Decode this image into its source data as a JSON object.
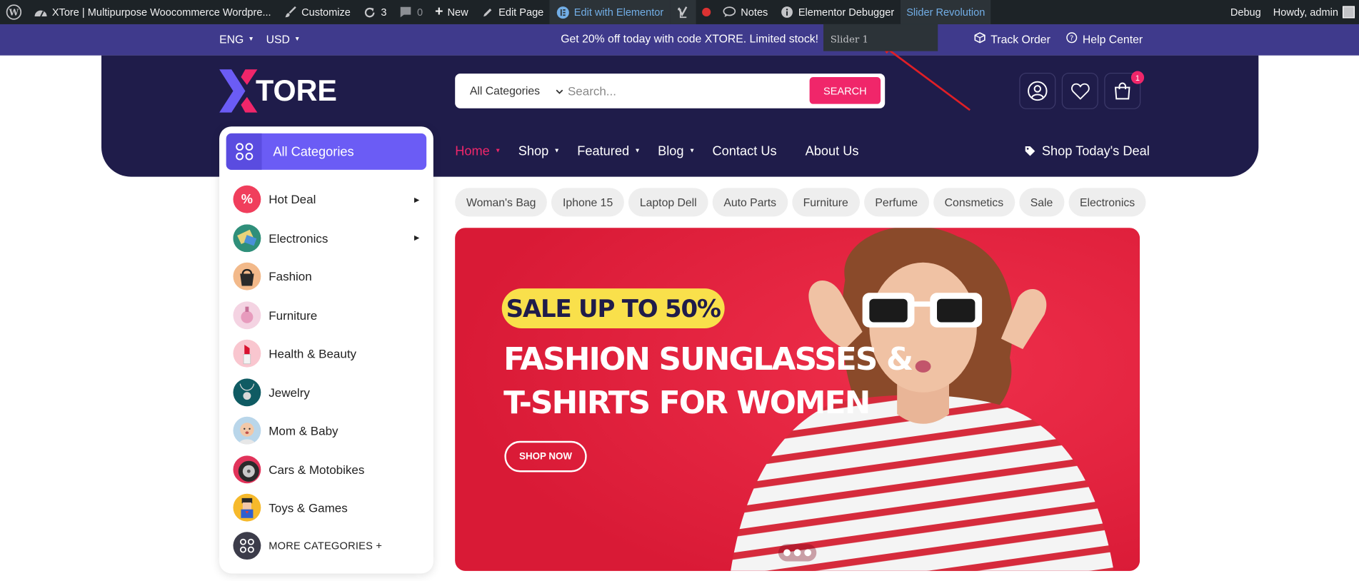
{
  "admin_bar": {
    "site_name": "XTore | Multipurpose Woocommerce Wordpre...",
    "customize": "Customize",
    "updates": "3",
    "comments": "0",
    "new": "New",
    "edit_page": "Edit Page",
    "edit_elementor": "Edit with Elementor",
    "notes": "Notes",
    "debugger": "Elementor Debugger",
    "slider_revolution": "Slider Revolution",
    "debug": "Debug",
    "howdy": "Howdy, admin",
    "dropdown_item": "Slider 1"
  },
  "topbar": {
    "language": "ENG",
    "currency": "USD",
    "promo": "Get 20% off today with code XTORE. Limited stock!",
    "track_order": "Track Order",
    "help_center": "Help Center"
  },
  "header": {
    "logo": "TORE",
    "search": {
      "category": "All Categories",
      "placeholder": "Search...",
      "button": "SEARCH"
    },
    "cart_count": "1"
  },
  "nav": {
    "items": [
      {
        "label": "Home"
      },
      {
        "label": "Shop"
      },
      {
        "label": "Featured"
      },
      {
        "label": "Blog"
      },
      {
        "label": "Contact Us"
      },
      {
        "label": "About Us"
      }
    ],
    "deal": "Shop Today's Deal"
  },
  "sidebar": {
    "title": "All Categories",
    "items": [
      {
        "label": "Hot Deal"
      },
      {
        "label": "Electronics"
      },
      {
        "label": "Fashion"
      },
      {
        "label": "Furniture"
      },
      {
        "label": "Health & Beauty"
      },
      {
        "label": "Jewelry"
      },
      {
        "label": "Mom & Baby"
      },
      {
        "label": "Cars & Motobikes"
      },
      {
        "label": "Toys & Games"
      }
    ],
    "more": "MORE CATEGORIES +"
  },
  "tags": [
    "Woman's Bag",
    "Iphone 15",
    "Laptop Dell",
    "Auto Parts",
    "Furniture",
    "Perfume",
    "Consmetics",
    "Sale",
    "Electronics"
  ],
  "banner": {
    "badge": "SALE UP TO 50%",
    "line1": "FASHION SUNGLASSES &",
    "line2": "T-SHIRTS FOR WOMEN",
    "button": "SHOP NOW"
  },
  "colors": {
    "admin_bar": "#1d2327",
    "promo_bar": "#3f3a8c",
    "header": "#1f1c4a",
    "accent_pink": "#f0266a",
    "accent_purple": "#6b5cf5",
    "banner_red": "#e3213e",
    "badge_yellow": "#f9e04b"
  }
}
